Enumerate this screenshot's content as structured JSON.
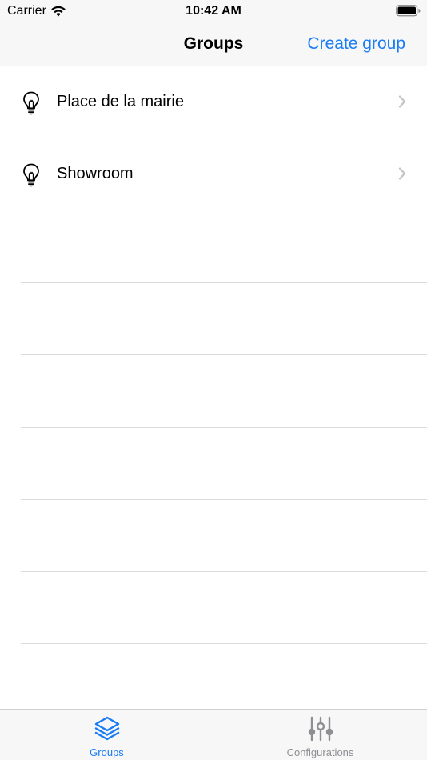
{
  "status_bar": {
    "carrier": "Carrier",
    "time": "10:42 AM"
  },
  "nav": {
    "title": "Groups",
    "action_label": "Create group"
  },
  "groups": [
    {
      "label": "Place de la mairie",
      "icon": "lightbulb-icon"
    },
    {
      "label": "Showroom",
      "icon": "lightbulb-icon"
    }
  ],
  "tabs": [
    {
      "label": "Groups",
      "icon": "layers-icon",
      "selected": true
    },
    {
      "label": "Configurations",
      "icon": "sliders-icon",
      "selected": false
    }
  ],
  "colors": {
    "accent": "#1a7cf2",
    "inactive": "#8e8e93",
    "bar_background": "#f7f7f7",
    "separator": "#dcdcde"
  }
}
